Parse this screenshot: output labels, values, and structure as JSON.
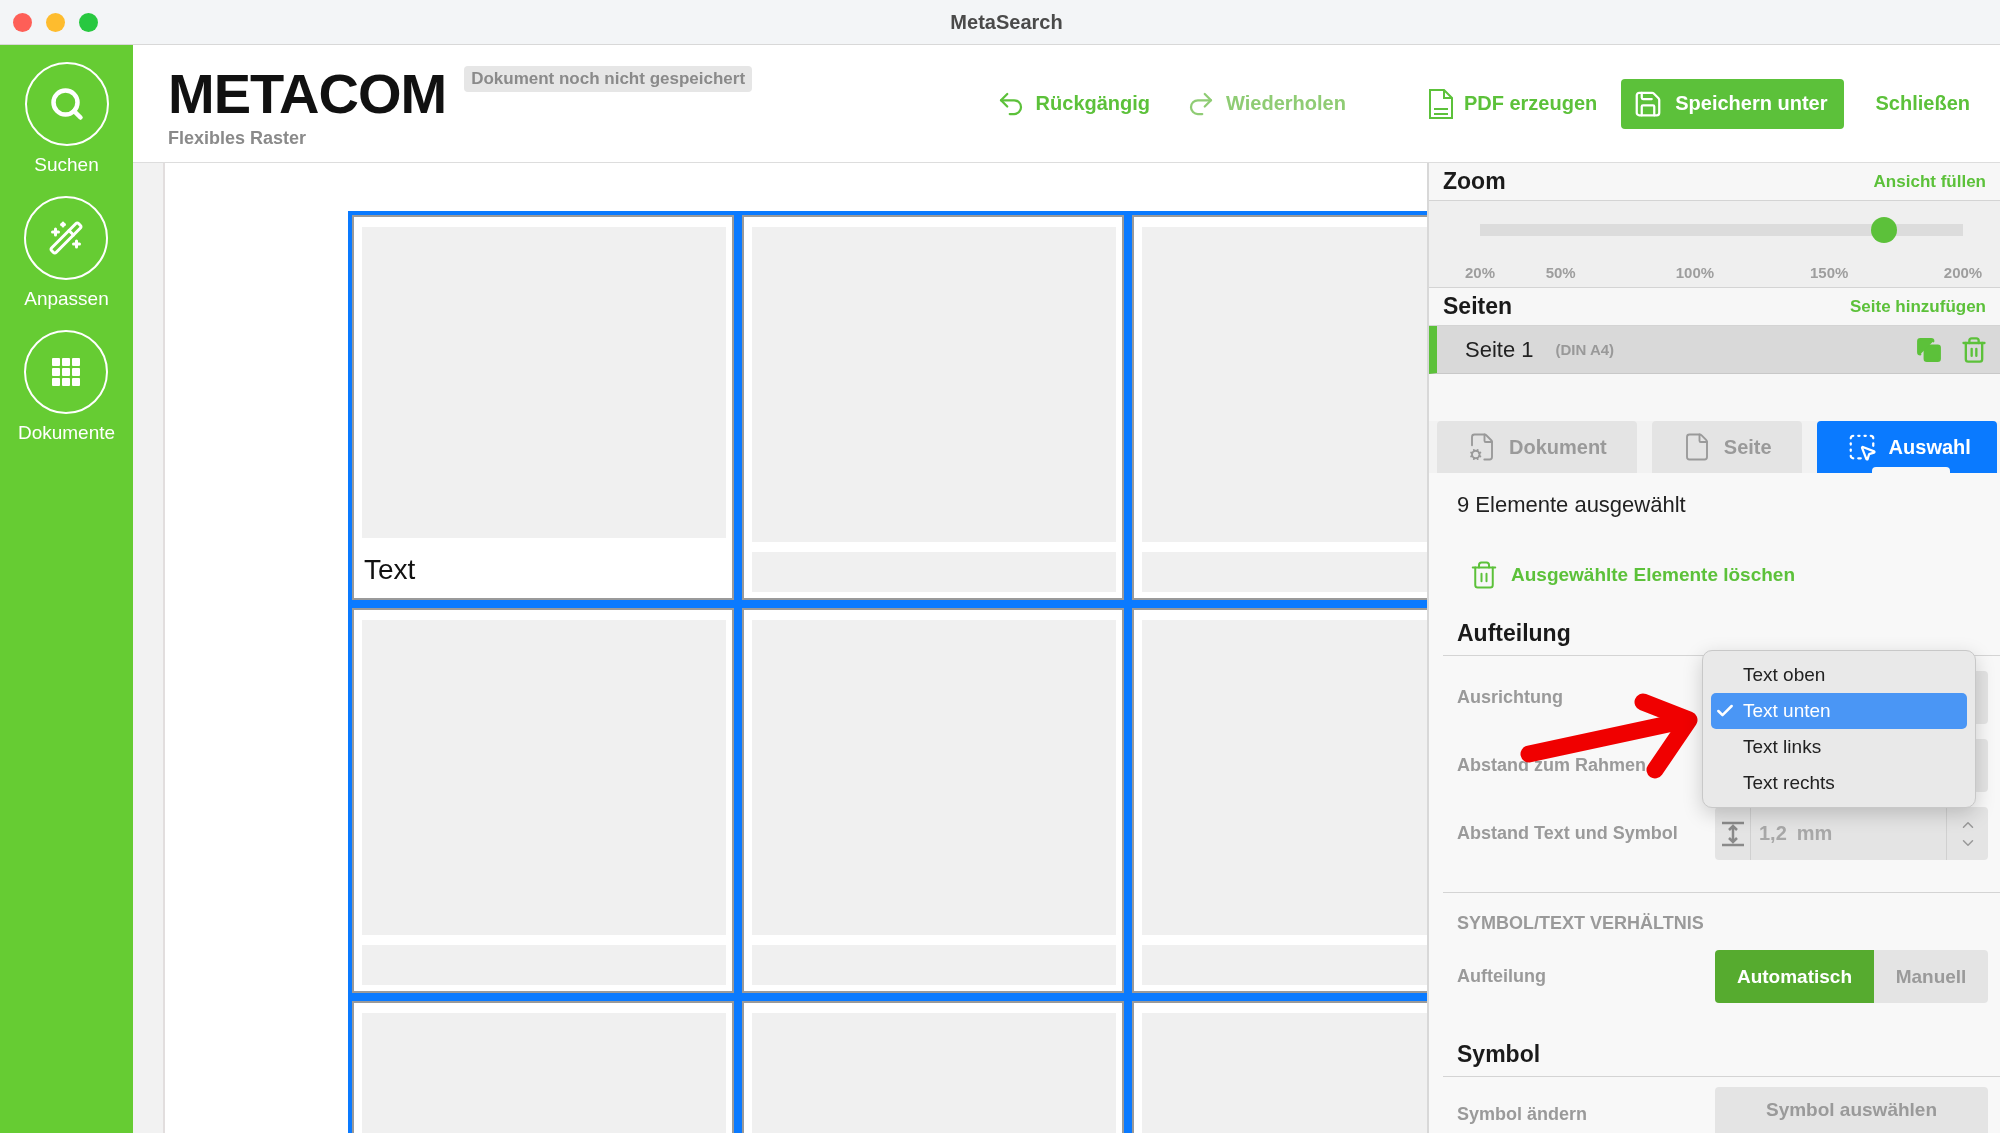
{
  "window": {
    "title": "MetaSearch"
  },
  "sidebar": {
    "items": [
      {
        "kind": "search",
        "label": "Suchen"
      },
      {
        "kind": "adjust",
        "label": "Anpassen"
      },
      {
        "kind": "documents",
        "label": "Dokumente"
      }
    ]
  },
  "header": {
    "logo": "METACOM",
    "status_badge": "Dokument noch nicht gespeichert",
    "subtitle": "Flexibles Raster",
    "actions": [
      {
        "kind": "undo",
        "label": "Rückgängig",
        "disabled": false
      },
      {
        "kind": "redo",
        "label": "Wiederholen",
        "disabled": true
      },
      {
        "kind": "pdf",
        "label": "PDF erzeugen",
        "disabled": false
      },
      {
        "kind": "save",
        "label": "Speichern unter",
        "disabled": false
      },
      {
        "kind": "close",
        "label": "Schließen",
        "disabled": false
      }
    ]
  },
  "canvas": {
    "cells": [
      {
        "kind": "text",
        "text": "Text"
      },
      {
        "kind": "blank"
      },
      {
        "kind": "blank"
      },
      {
        "kind": "blank"
      },
      {
        "kind": "blank"
      },
      {
        "kind": "blank"
      },
      {
        "kind": "cut"
      },
      {
        "kind": "cut"
      },
      {
        "kind": "cut"
      }
    ]
  },
  "panel": {
    "zoom": {
      "title": "Zoom",
      "action": "Ansicht füllen",
      "level": 0.837,
      "ticks": [
        "20%",
        "50%",
        "100%",
        "150%",
        "200%"
      ]
    },
    "pages": {
      "title": "Seiten",
      "action": "Seite hinzufügen",
      "items": [
        {
          "name": "Seite 1",
          "format": "(DIN A4)",
          "selected": true
        }
      ]
    },
    "tabs": [
      {
        "kind": "document",
        "label": "Dokument",
        "selected": false
      },
      {
        "kind": "page",
        "label": "Seite",
        "selected": false
      },
      {
        "kind": "selection",
        "label": "Auswahl",
        "selected": true
      }
    ],
    "selection_info": "9 Elemente ausgewählt",
    "delete_action": "Ausgewählte Elemente löschen",
    "layout_section": {
      "title": "Aufteilung",
      "rows": [
        {
          "kind": "select",
          "label": "Ausrichtung"
        },
        {
          "kind": "input",
          "label": "Abstand zum Rahmen"
        },
        {
          "kind": "stepper",
          "label": "Abstand Text und Symbol",
          "value": "1,2",
          "unit": "mm"
        }
      ]
    },
    "dropdown": {
      "options": [
        {
          "label": "Text oben",
          "selected": false
        },
        {
          "label": "Text unten",
          "selected": true
        },
        {
          "label": "Text links",
          "selected": false
        },
        {
          "label": "Text rechts",
          "selected": false
        }
      ]
    },
    "ratio_section": {
      "title": "SYMBOL/TEXT VERHÄLTNIS",
      "label": "Aufteilung",
      "options": [
        {
          "label": "Automatisch",
          "selected": true
        },
        {
          "label": "Manuell",
          "selected": false
        }
      ]
    },
    "symbol_section": {
      "title": "Symbol",
      "label": "Symbol ändern",
      "button": "Symbol auswählen"
    }
  }
}
